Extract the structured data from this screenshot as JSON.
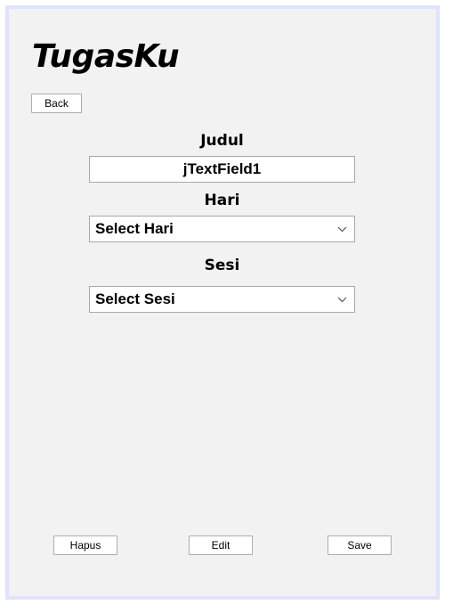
{
  "app": {
    "title": "TugasKu"
  },
  "buttons": {
    "back": "Back",
    "hapus": "Hapus",
    "edit": "Edit",
    "save": "Save"
  },
  "form": {
    "judul_label": "Judul",
    "judul_value": "jTextField1",
    "hari_label": "Hari",
    "hari_selected": "Select Hari",
    "sesi_label": "Sesi",
    "sesi_selected": "Select Sesi"
  },
  "icons": {
    "dropdown": "chevron-down-icon"
  },
  "colors": {
    "window_border": "#dfe3fb",
    "window_background": "#f2f2f2",
    "field_border": "#a8a8a8"
  }
}
